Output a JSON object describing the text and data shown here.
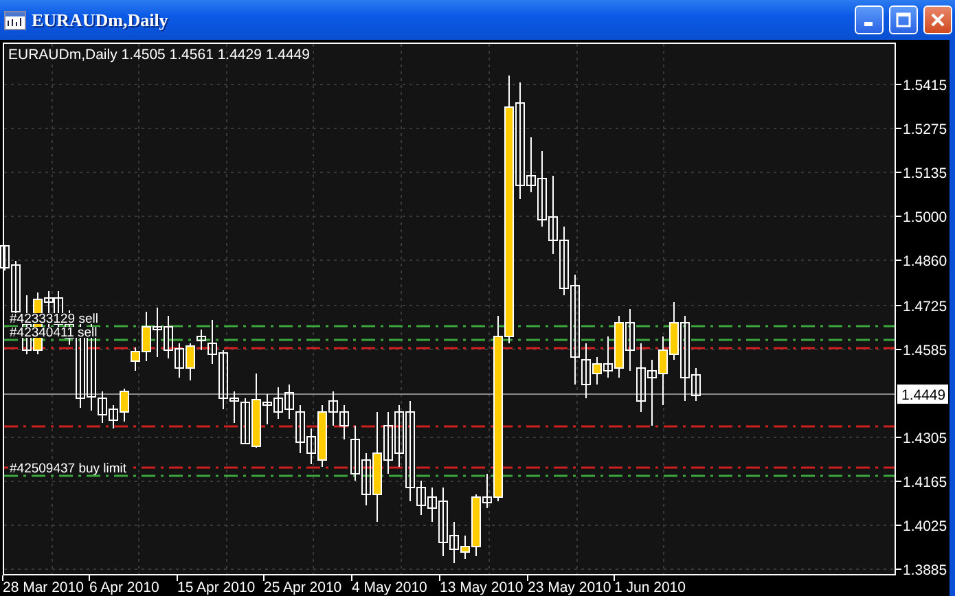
{
  "window": {
    "title": "EURAUDm,Daily"
  },
  "chart": {
    "header": "EURAUDm,Daily  1.4505 1.4561 1.4429 1.4449",
    "price_axis": [
      "1.5415",
      "1.5275",
      "1.5135",
      "1.5000",
      "1.4860",
      "1.4725",
      "1.4585",
      "1.4305",
      "1.4165",
      "1.4025",
      "1.3885"
    ],
    "current_price": "1.4449",
    "date_axis": [
      "28 Mar 2010",
      "6 Apr 2010",
      "15 Apr 2010",
      "25 Apr 2010",
      "4 May 2010",
      "13 May 2010",
      "23 May 2010",
      "1 Jun 2010"
    ],
    "order_lines": [
      {
        "label": "#42333129 sell",
        "color": "#3aa53a"
      },
      {
        "label": "#42340411 sell",
        "color": "#3aa53a"
      },
      {
        "color": "#d02020"
      },
      {
        "color": "#d02020"
      },
      {
        "color": "#d02020"
      },
      {
        "label": "#42509437 buy limit",
        "color": "#3aa53a"
      }
    ]
  }
}
